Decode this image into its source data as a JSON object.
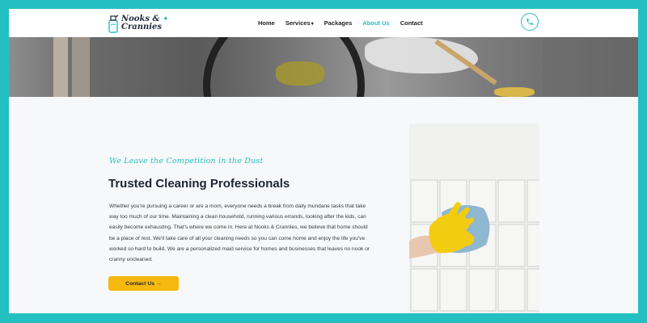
{
  "brand": {
    "line1": "Nooks &",
    "line2": "Crannies"
  },
  "nav": {
    "items": [
      {
        "label": "Home",
        "active": false
      },
      {
        "label": "Services",
        "active": false,
        "has_caret": true
      },
      {
        "label": "Packages",
        "active": false
      },
      {
        "label": "About Us",
        "active": true
      },
      {
        "label": "Contact",
        "active": false
      }
    ],
    "caret": "▾"
  },
  "content": {
    "tagline": "We Leave the Competition in the Dust",
    "title": "Trusted Cleaning Professionals",
    "body": "Whether you're pursuing a career or are a mom, everyone needs a break from daily mundane tasks that take way too much of our time. Maintaining a clean household, running various errands, looking after the kids, can easily become exhausting. That's where we come in. Here at Nooks & Crannies, we believe that home should be a place of rest. We'll take care of all your cleaning needs so you can come home and enjoy the life you've worked so hard to build. We are a personalized maid service for homes and businesses that leaves no nook or cranny uncleaned.",
    "cta_label": "Contact Us",
    "cta_arrow": "→"
  },
  "colors": {
    "accent": "#24bfc0",
    "button": "#f5b90f",
    "heading": "#1e2433"
  },
  "icons": {
    "logo": "spray-bottle-icon",
    "phone": "phone-icon",
    "arrow": "arrow-right-icon"
  }
}
